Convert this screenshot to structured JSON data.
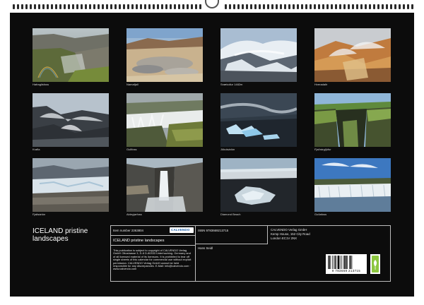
{
  "photos": [
    {
      "caption": "Hafragilsfoss"
    },
    {
      "caption": "Namafjall"
    },
    {
      "caption": "Snækollur 1482m"
    },
    {
      "caption": "Hveradalir"
    },
    {
      "caption": "Krafla"
    },
    {
      "caption": "Gullfoss"
    },
    {
      "caption": "Jökulsárlón"
    },
    {
      "caption": "Fjaðrárgljúfur"
    },
    {
      "caption": "Fjallsárlón"
    },
    {
      "caption": "Aldeyjarfoss"
    },
    {
      "caption": "Diamond Beach"
    },
    {
      "caption": "Goðafoss"
    }
  ],
  "title": {
    "line1": "ICELAND pristine",
    "line2": "landscapes"
  },
  "info": {
    "item_number": "Item number 2363804",
    "logo_text": "CALVENDO",
    "calendar_title": "ICELAND pristine landscapes",
    "notice_text": "This publication is subject to copyright of CALVENDO Verlag GmbH Ottostrasse 3, D-8 D-80333 Unterhaching. Germany and of all licensed material of its licensors. It is prohibited to tear off single sheets of this calendar for commercial use without explicit permission. CALVENDO Verlag GmbH cannot be held responsible for any discrepancies. E-Mail: info@calvendo.com · www.calvendo.com",
    "isbn": "ISBN 9783669213715",
    "author": "Hans Seidl",
    "publisher": [
      "CALVENDO Verlag GmbH",
      "Kemp House, 152 City Road",
      "London EC1V 2NX"
    ],
    "barcode_number": "9 783669 213715"
  },
  "colors": {
    "page": "#0c0c0c",
    "border": "#bdbdbd",
    "eco_label": "#8cc63f"
  }
}
